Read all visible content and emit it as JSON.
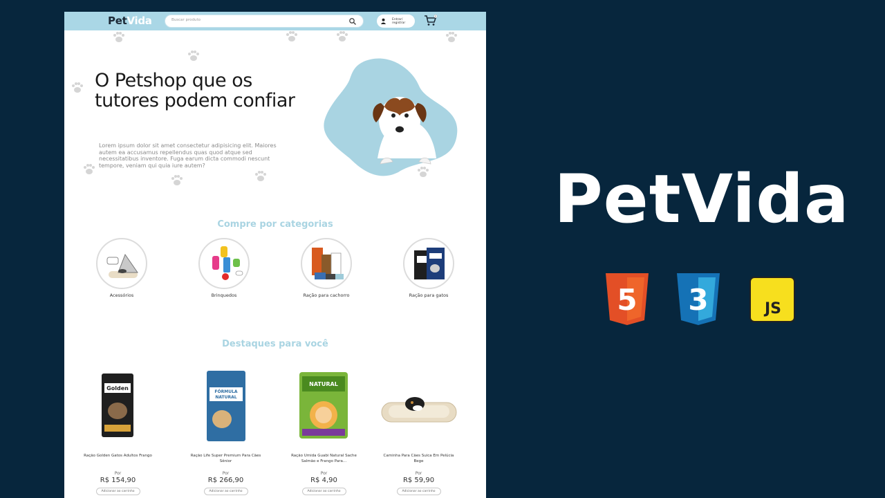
{
  "site": {
    "logo": {
      "pet": "Pet",
      "vida": "Vida"
    },
    "search": {
      "placeholder": "Buscar produto"
    },
    "login_label": "Entrar/ registrar",
    "cart_count": "0",
    "hero": {
      "title": "O Petshop que os tutores podem confiar",
      "text": "Lorem ipsum dolor sit amet consectetur adipisicing elit. Maiores autem ea accusamus repellendus quas quod atque sed necessitatibus inventore. Fuga earum dicta commodi nescunt tempore, veniam qui quia iure autem?"
    },
    "categories_title": "Compre por categorias",
    "categories": [
      {
        "label": "Acessórios"
      },
      {
        "label": "Brinquedos"
      },
      {
        "label": "Ração para cachorro"
      },
      {
        "label": "Ração para gatos"
      }
    ],
    "featured_title": "Destaques para você",
    "products": [
      {
        "name": "Ração Golden Gatos Adultos Frango",
        "por": "Por",
        "price": "R$ 154,90",
        "button": "Adicionar ao carrinho"
      },
      {
        "name": "Ração Life Super Premium Para Cães Sênior",
        "por": "Por",
        "price": "R$ 266,90",
        "button": "Adicionar ao carrinho"
      },
      {
        "name": "Ração Umida Guabi Natural Sache Salmão e Frango Para...",
        "por": "Por",
        "price": "R$ 4,90",
        "button": "Adicionar ao carrinho"
      },
      {
        "name": "Caminha Para Cães Suica Em Pelúcia Bege",
        "por": "Por",
        "price": "R$ 59,90",
        "button": "Adicionar ao carrinho"
      }
    ]
  },
  "brand": {
    "title": "PetVida",
    "tech": [
      {
        "icon": "html5-icon",
        "label": "5",
        "color": "#e34f26"
      },
      {
        "icon": "css3-icon",
        "label": "3",
        "color": "#2196f3"
      },
      {
        "icon": "javascript-icon",
        "label": "JS",
        "color": "#f7df1e"
      }
    ]
  },
  "colors": {
    "background": "#07263d",
    "header": "#aad7e6",
    "accent": "#a9d4e2"
  }
}
